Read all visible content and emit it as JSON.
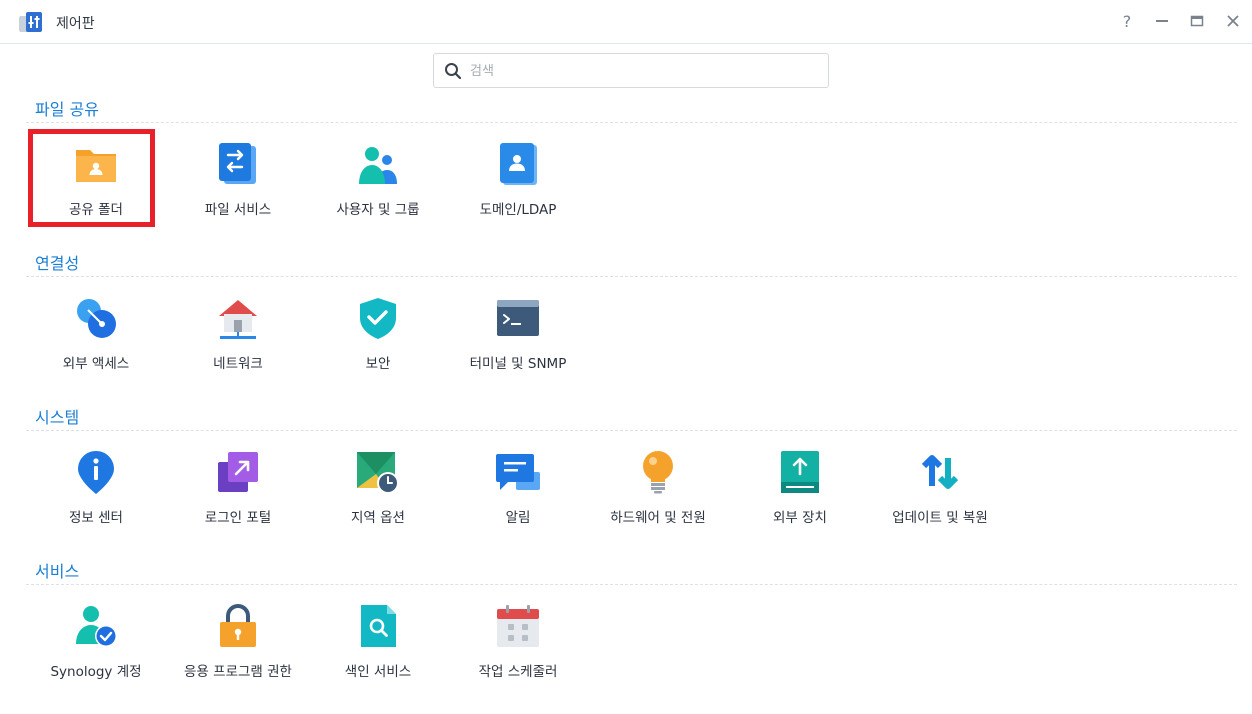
{
  "window": {
    "title": "제어판",
    "help_icon": "?",
    "minimize_icon": "—",
    "maximize_icon": "▭",
    "close_icon": "✕"
  },
  "search": {
    "placeholder": "검색",
    "value": ""
  },
  "sections": [
    {
      "title": "파일 공유",
      "items": [
        {
          "label": "공유 폴더",
          "icon": "shared-folder-icon"
        },
        {
          "label": "파일 서비스",
          "icon": "file-services-icon"
        },
        {
          "label": "사용자 및 그룹",
          "icon": "users-groups-icon"
        },
        {
          "label": "도메인/LDAP",
          "icon": "domain-ldap-icon"
        }
      ]
    },
    {
      "title": "연결성",
      "items": [
        {
          "label": "외부 액세스",
          "icon": "external-access-icon"
        },
        {
          "label": "네트워크",
          "icon": "network-icon"
        },
        {
          "label": "보안",
          "icon": "security-shield-icon"
        },
        {
          "label": "터미널 및 SNMP",
          "icon": "terminal-icon"
        }
      ]
    },
    {
      "title": "시스템",
      "items": [
        {
          "label": "정보 센터",
          "icon": "info-center-icon"
        },
        {
          "label": "로그인 포털",
          "icon": "login-portal-icon"
        },
        {
          "label": "지역 옵션",
          "icon": "regional-options-icon"
        },
        {
          "label": "알림",
          "icon": "notification-icon"
        },
        {
          "label": "하드웨어 및 전원",
          "icon": "hardware-power-icon"
        },
        {
          "label": "외부 장치",
          "icon": "external-devices-icon"
        },
        {
          "label": "업데이트 및 복원",
          "icon": "update-restore-icon"
        }
      ]
    },
    {
      "title": "서비스",
      "items": [
        {
          "label": "Synology 계정",
          "icon": "synology-account-icon"
        },
        {
          "label": "응용 프로그램 권한",
          "icon": "application-privileges-icon"
        },
        {
          "label": "색인 서비스",
          "icon": "indexing-service-icon"
        },
        {
          "label": "작업 스케줄러",
          "icon": "task-scheduler-icon"
        }
      ]
    }
  ],
  "highlighted_item": "공유 폴더",
  "colors": {
    "section_title": "#1c7fd6",
    "highlight_border": "#e8202a"
  }
}
